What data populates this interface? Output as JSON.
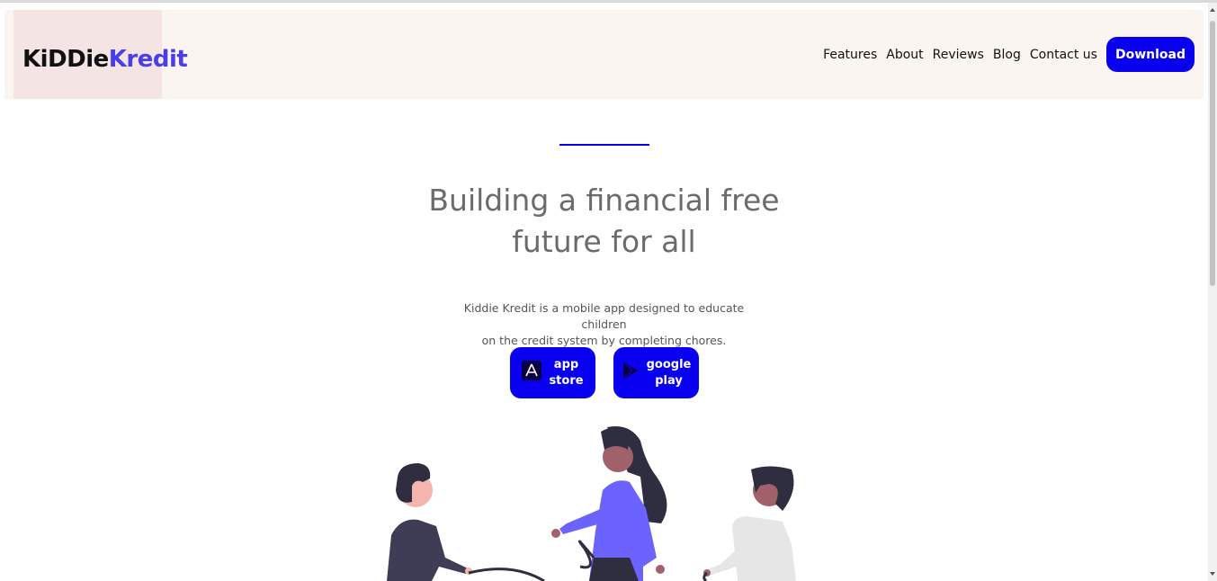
{
  "header": {
    "logo": {
      "part1": "KiDDie",
      "part2": "Kredit"
    },
    "nav": [
      "Features",
      "About",
      "Reviews",
      "Blog",
      "Contact us"
    ],
    "download_label": "Download"
  },
  "hero": {
    "title_line1": "Building a financial free",
    "title_line2": "future for all",
    "desc_line1": "Kiddie Kredit is a mobile app designed to educate children",
    "desc_line2": "on the credit system by completing chores.",
    "app_store": {
      "line1": "app",
      "line2": "store",
      "icon": "app-store-icon"
    },
    "google_play": {
      "line1": "google",
      "line2": "play",
      "icon": "google-play-icon"
    }
  },
  "colors": {
    "accent": "#0a00f0",
    "logo_accent": "#4a3ee8",
    "header_bg": "#faf5f0",
    "logo_bg": "#f4e4e4",
    "title": "#6b6b6b"
  }
}
